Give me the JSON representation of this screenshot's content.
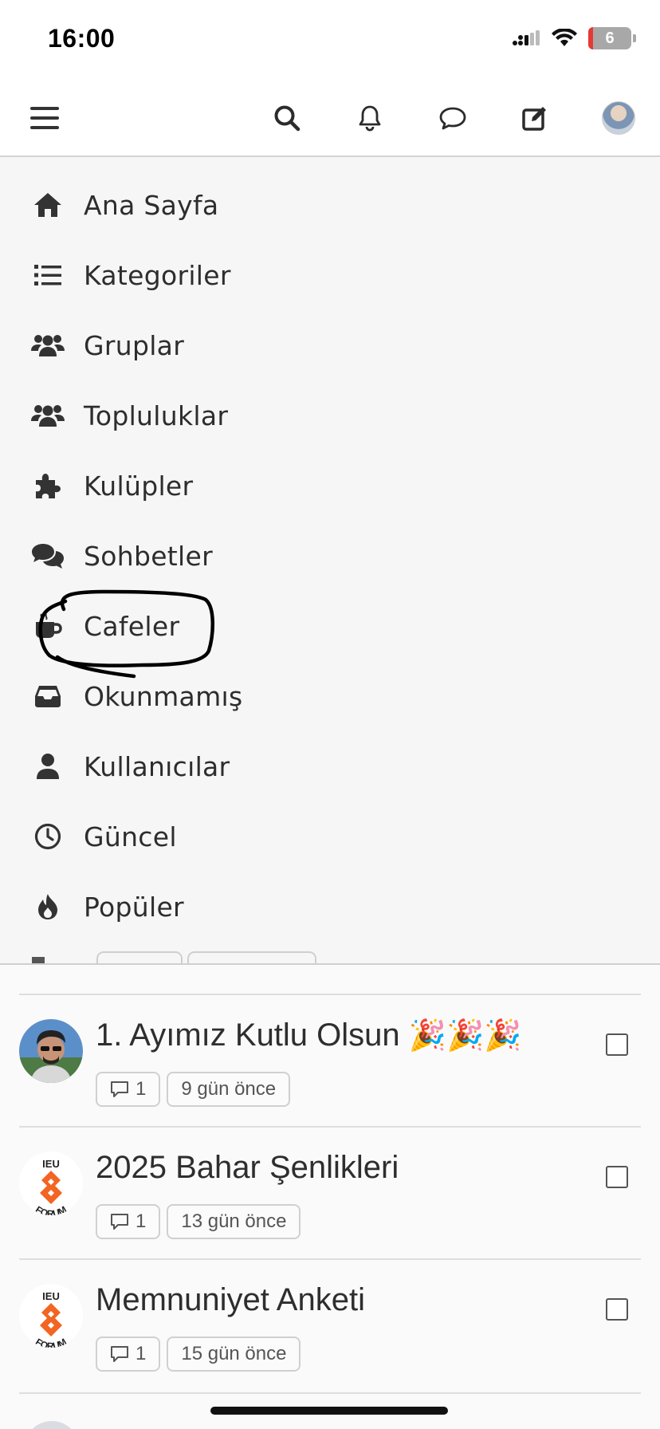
{
  "status_bar": {
    "time": "16:00",
    "battery": "6"
  },
  "header": {
    "icons": [
      "menu-icon",
      "search-icon",
      "bell-icon",
      "chat-icon",
      "compose-icon",
      "avatar"
    ]
  },
  "menu": {
    "items": [
      {
        "label": "Ana Sayfa",
        "icon": "home-icon"
      },
      {
        "label": "Kategoriler",
        "icon": "list-icon"
      },
      {
        "label": "Gruplar",
        "icon": "users-icon"
      },
      {
        "label": "Topluluklar",
        "icon": "users-icon"
      },
      {
        "label": "Kulüpler",
        "icon": "puzzle-icon"
      },
      {
        "label": "Sohbetler",
        "icon": "comments-icon"
      },
      {
        "label": "Cafeler",
        "icon": "coffee-icon"
      },
      {
        "label": "Okunmamış",
        "icon": "inbox-icon"
      },
      {
        "label": "Kullanıcılar",
        "icon": "user-icon"
      },
      {
        "label": "Güncel",
        "icon": "clock-icon"
      },
      {
        "label": "Popüler",
        "icon": "fire-icon"
      }
    ]
  },
  "topics": [
    {
      "title": "1. Ayımız Kutlu Olsun",
      "emoji": "🎉🎉🎉",
      "replies": "1",
      "time": "9 gün önce",
      "avatar": "user-photo"
    },
    {
      "title": "2025 Bahar Şenlikleri",
      "emoji": "",
      "replies": "1",
      "time": "13 gün önce",
      "avatar": "ieu-forum-logo"
    },
    {
      "title": "Memnuniyet Anketi",
      "emoji": "",
      "replies": "1",
      "time": "15 gün önce",
      "avatar": "ieu-forum-logo"
    }
  ],
  "logo": {
    "top": "IEU",
    "bottom": "FORUM"
  },
  "colors": {
    "accent": "#f26522",
    "text": "#2b2b2b",
    "divider": "#dedede"
  }
}
